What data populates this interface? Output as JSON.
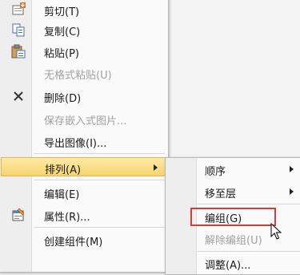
{
  "main_menu": {
    "items": [
      {
        "label": "剪切(T)",
        "icon": "cut-icon",
        "enabled": true
      },
      {
        "label": "复制(C)",
        "icon": "copy-icon",
        "enabled": true
      },
      {
        "label": "粘贴(P)",
        "icon": "paste-icon",
        "enabled": true
      },
      {
        "label": "无格式粘贴(U)",
        "icon": "",
        "enabled": false
      },
      {
        "label": "删除(D)",
        "icon": "delete-icon",
        "enabled": true
      },
      {
        "label": "保存嵌入式图片...",
        "icon": "",
        "enabled": false
      },
      {
        "label": "导出图像(I)...",
        "icon": "",
        "enabled": true
      },
      {
        "label": "排列(A)",
        "icon": "",
        "enabled": true,
        "submenu": true,
        "highlighted": true
      },
      {
        "label": "编辑(E)",
        "icon": "",
        "enabled": true
      },
      {
        "label": "属性(R)...",
        "icon": "properties-icon",
        "enabled": true
      },
      {
        "label": "创建组件(M)",
        "icon": "",
        "enabled": true
      }
    ]
  },
  "sub_menu": {
    "items": [
      {
        "label": "顺序",
        "submenu": true,
        "enabled": true
      },
      {
        "label": "移至层",
        "submenu": true,
        "enabled": true
      },
      {
        "label": "编组(G)",
        "enabled": true,
        "annotated": true
      },
      {
        "label": "解除编组(U)",
        "enabled": false
      },
      {
        "label": "调整(A)...",
        "enabled": true
      }
    ]
  },
  "colors": {
    "highlight": "#f7d46e",
    "annotation_box": "#d83b3b",
    "disabled_text": "#a0a0a0"
  }
}
